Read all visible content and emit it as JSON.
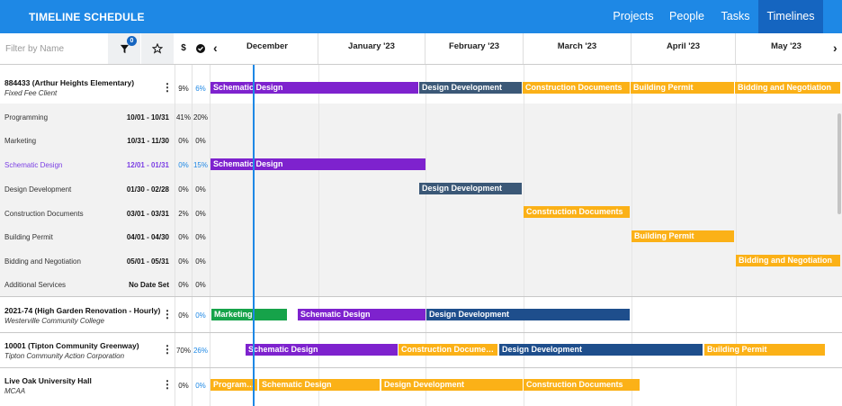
{
  "app": {
    "title": "TIMELINE SCHEDULE"
  },
  "nav": [
    {
      "label": "Projects",
      "active": false
    },
    {
      "label": "People",
      "active": false
    },
    {
      "label": "Tasks",
      "active": false
    },
    {
      "label": "Timelines",
      "active": true
    }
  ],
  "toolbar": {
    "filter_placeholder": "Filter by Name",
    "filter_count": "0",
    "fee_header": "$",
    "complete_header": "✔",
    "prev_arrow": "‹",
    "next_arrow": "›"
  },
  "months": [
    "December",
    "January '23",
    "February '23",
    "March '23",
    "April '23",
    "May '23"
  ],
  "colors": {
    "header": "#1e88e5",
    "purple": "#7e22ce",
    "slate": "#3b5877",
    "gold": "#fbb117",
    "navy": "#1e4e8c",
    "green": "#16a34a",
    "today": "#1e88e5"
  },
  "projects": [
    {
      "name": "884433 (Arthur Heights Elementary)",
      "client": "Fixed Fee Client",
      "fee_pct": "9%",
      "complete_pct": "6%",
      "bars": [
        {
          "label": "Schematic Design"
        },
        {
          "label": "Design Development"
        },
        {
          "label": "Construction Documents"
        },
        {
          "label": "Building Permit"
        },
        {
          "label": "Bidding and Negotiation"
        }
      ],
      "phases": [
        {
          "name": "Programming",
          "dates": "10/01 - 10/31",
          "fee": "41%",
          "complete": "20%"
        },
        {
          "name": "Marketing",
          "dates": "10/31 - 11/30",
          "fee": "0%",
          "complete": "0%"
        },
        {
          "name": "Schematic Design",
          "dates": "12/01 - 01/31",
          "fee": "0%",
          "complete": "15%",
          "bar": "Schematic Design"
        },
        {
          "name": "Design Development",
          "dates": "01/30 - 02/28",
          "fee": "0%",
          "complete": "0%",
          "bar": "Design Development"
        },
        {
          "name": "Construction Documents",
          "dates": "03/01 - 03/31",
          "fee": "2%",
          "complete": "0%",
          "bar": "Construction Documents"
        },
        {
          "name": "Building Permit",
          "dates": "04/01 - 04/30",
          "fee": "0%",
          "complete": "0%",
          "bar": "Building Permit"
        },
        {
          "name": "Bidding and Negotiation",
          "dates": "05/01 - 05/31",
          "fee": "0%",
          "complete": "0%",
          "bar": "Bidding and Negotiation"
        },
        {
          "name": "Additional Services",
          "dates": "No Date Set",
          "fee": "0%",
          "complete": "0%"
        }
      ]
    },
    {
      "name": "2021-74 (High Garden Renovation - Hourly)",
      "client": "Westerville Community College",
      "fee_pct": "0%",
      "complete_pct": "0%",
      "bars": [
        {
          "label": "Marketing"
        },
        {
          "label": "Schematic Design"
        },
        {
          "label": "Design Development"
        }
      ]
    },
    {
      "name": "10001 (Tipton Community Greenway)",
      "client": "Tipton Community Action Corporation",
      "fee_pct": "70%",
      "complete_pct": "26%",
      "bars": [
        {
          "label": "Schematic Design"
        },
        {
          "label": "Construction Documents"
        },
        {
          "label": "Design Development"
        },
        {
          "label": "Building Permit"
        }
      ]
    },
    {
      "name": "Live Oak University Hall",
      "client": "MCAA",
      "fee_pct": "0%",
      "complete_pct": "0%",
      "bars": [
        {
          "label": "Programming"
        },
        {
          "label": "Schematic Design"
        },
        {
          "label": "Design Development"
        },
        {
          "label": "Construction Documents"
        }
      ]
    }
  ]
}
